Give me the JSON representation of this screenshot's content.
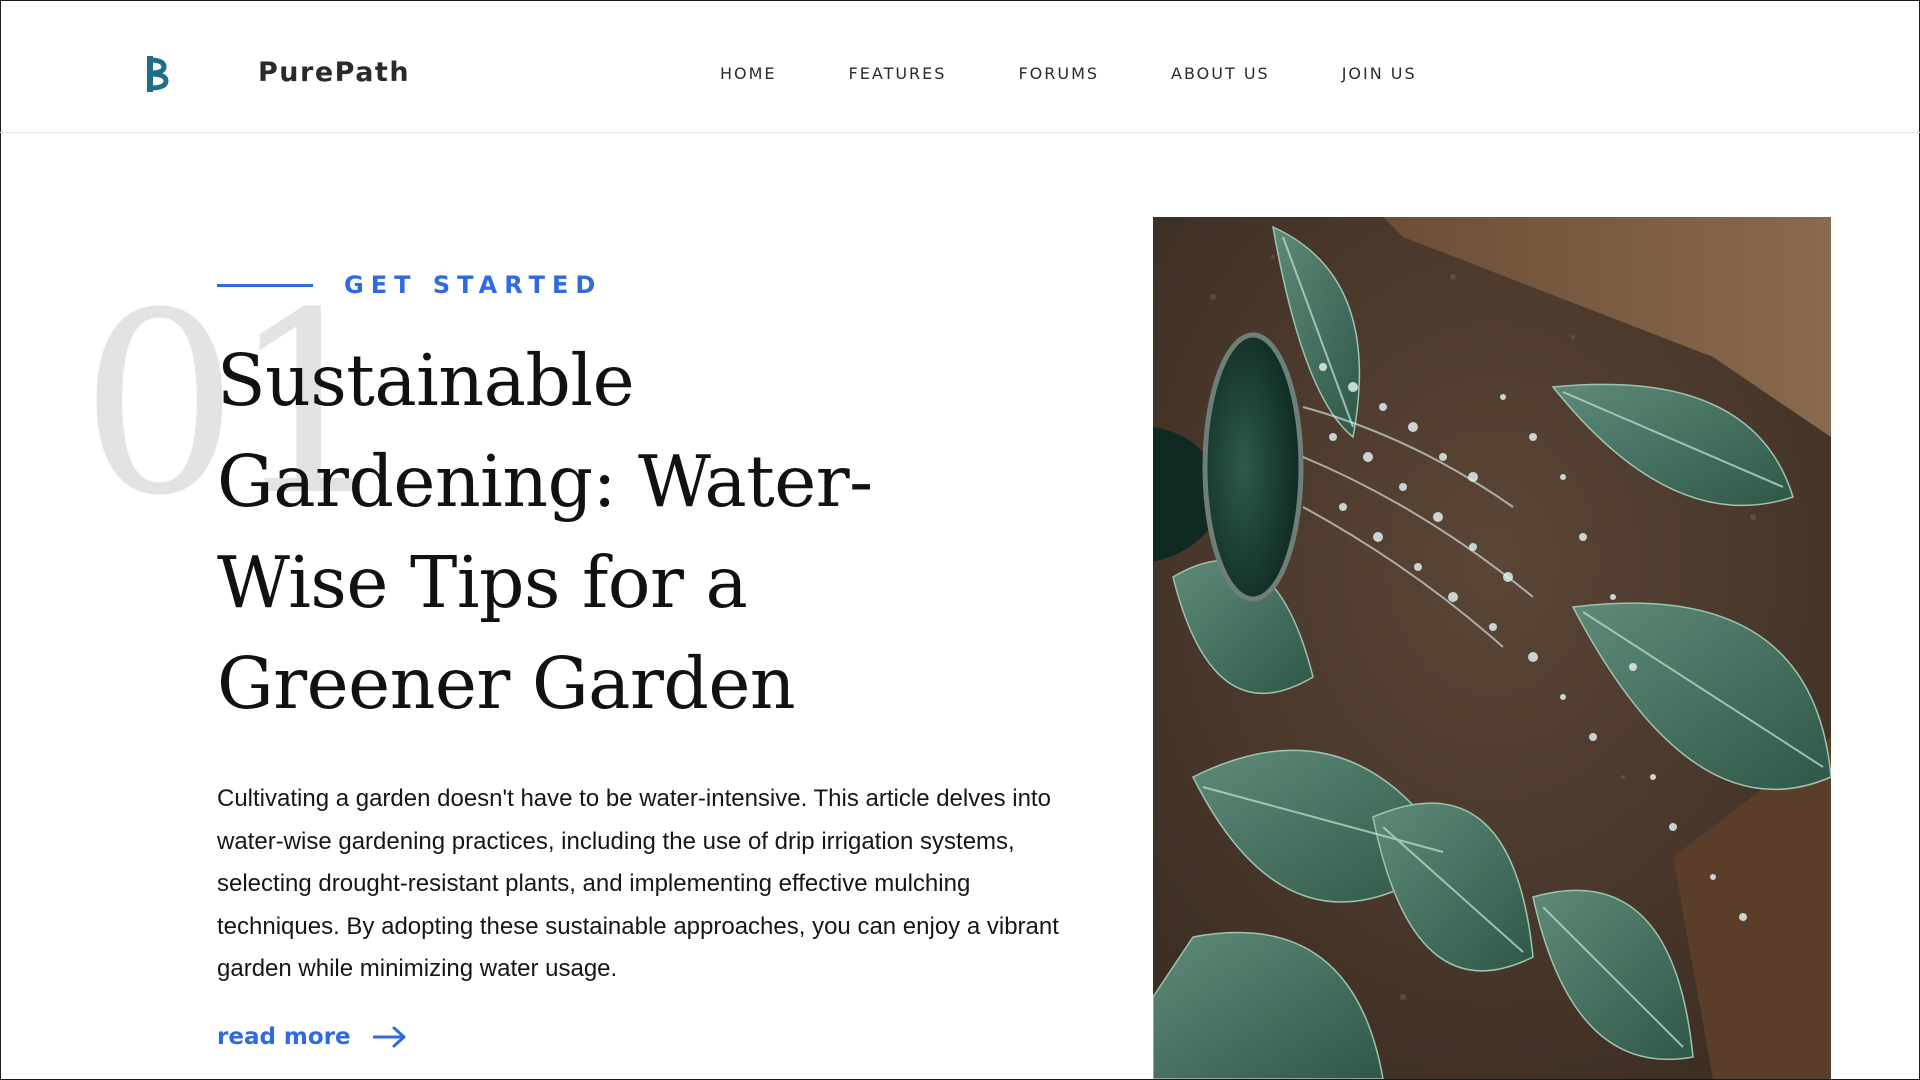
{
  "header": {
    "brand_name": "PurePath",
    "logo_icon": "purepath-logo-icon",
    "nav": [
      {
        "label": "HOME"
      },
      {
        "label": "FEATURES"
      },
      {
        "label": "FORUMS"
      },
      {
        "label": "ABOUT US"
      },
      {
        "label": "JOIN US"
      }
    ]
  },
  "hero": {
    "eyebrow": "GET STARTED",
    "number": "01",
    "title": "Sustainable Gardening: Water-Wise Tips for a Greener Garden",
    "body": "Cultivating a garden doesn't have to be water-intensive. This article delves into water-wise gardening practices, including the use of drip irrigation systems, selecting drought-resistant plants, and implementing effective mulching techniques. By adopting these sustainable approaches, you can enjoy a vibrant garden while minimizing water usage.",
    "read_more": "read more",
    "read_more_icon": "arrow-right-icon",
    "image_subject": "watering-can-sprinkling-plants-image"
  },
  "colors": {
    "accent": "#2f6ae0",
    "logo": "#1f6e86",
    "watermark_number": "#e3e3e3",
    "text": "#111111"
  }
}
